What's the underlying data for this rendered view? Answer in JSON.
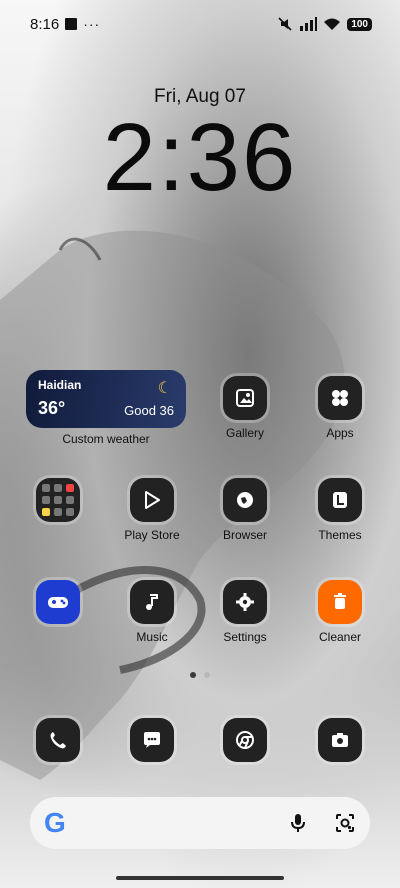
{
  "status_bar": {
    "time": "8:16",
    "more": "···",
    "battery": "100"
  },
  "lock": {
    "date": "Fri, Aug 07",
    "time": "2:36"
  },
  "weather": {
    "city": "Haidian",
    "temperature": "36°",
    "condition": "Good 36",
    "label": "Custom weather"
  },
  "apps": {
    "row1": [
      {
        "label": "Gallery"
      },
      {
        "label": "Apps"
      }
    ],
    "row2": [
      {
        "label": ""
      },
      {
        "label": "Play Store"
      },
      {
        "label": "Browser"
      },
      {
        "label": "Themes"
      }
    ],
    "row3": [
      {
        "label": ""
      },
      {
        "label": "Music"
      },
      {
        "label": "Settings"
      },
      {
        "label": "Cleaner"
      }
    ]
  },
  "dock": [
    {
      "name": "phone"
    },
    {
      "name": "messages"
    },
    {
      "name": "chrome"
    },
    {
      "name": "camera"
    }
  ],
  "search": {
    "logo": "G"
  },
  "colors": {
    "page_dot_active": "#3a3a3a",
    "page_dot_inactive": "#b8b8b8",
    "cleaner_accent": "#ff6a00",
    "game_accent": "#2c6cff"
  }
}
